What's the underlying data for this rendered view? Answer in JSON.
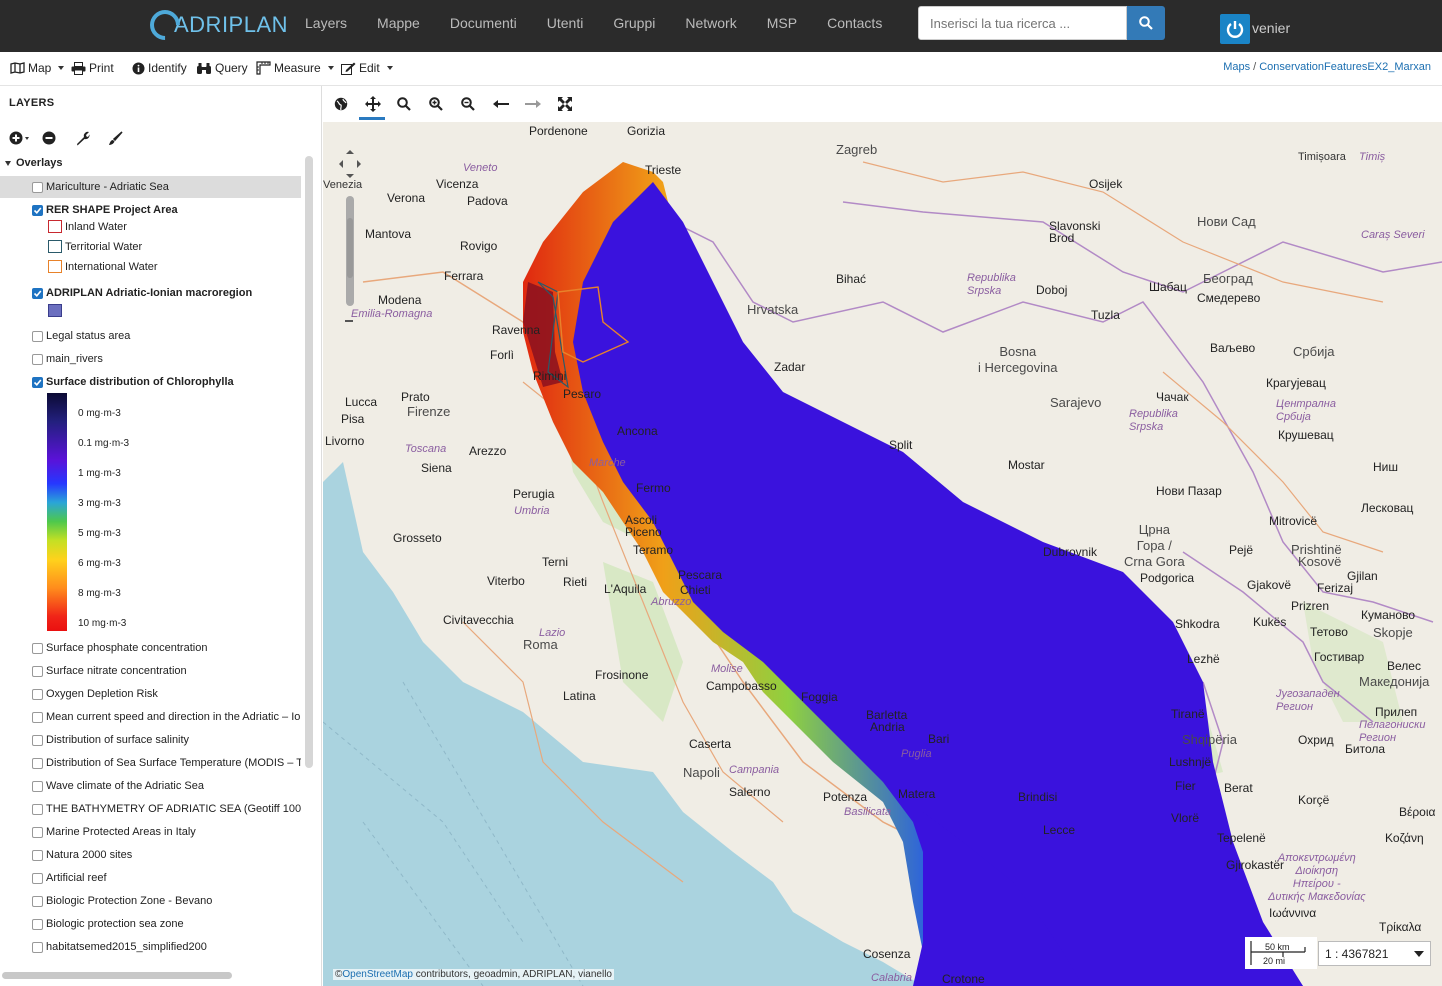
{
  "app": {
    "logo_text": "ADRIPLAN",
    "nav": [
      "Layers",
      "Mappe",
      "Documenti",
      "Utenti",
      "Gruppi",
      "Network",
      "MSP",
      "Contacts"
    ],
    "search_placeholder": "Inserisci la tua ricerca ...",
    "user": "venier"
  },
  "toolbar": {
    "map": "Map",
    "print": "Print",
    "identify": "Identify",
    "query": "Query",
    "measure": "Measure",
    "edit": "Edit",
    "breadcrumb_root": "Maps",
    "breadcrumb_sep": "/",
    "breadcrumb_current": "ConservationFeaturesEX2_Marxan"
  },
  "panel": {
    "title": "LAYERS",
    "group": "Overlays",
    "layers": [
      {
        "label": "Mariculture - Adriatic Sea",
        "checked": false
      },
      {
        "label": "RER SHAPE Project Area",
        "checked": true
      },
      {
        "label": "ADRIPLAN Adriatic-Ionian macroregion",
        "checked": true
      },
      {
        "label": "Legal status area",
        "checked": false
      },
      {
        "label": "main_rivers",
        "checked": false
      },
      {
        "label": "Surface distribution of Chlorophylla",
        "checked": true
      },
      {
        "label": "Surface phosphate concentration",
        "checked": false
      },
      {
        "label": "Surface nitrate concentration",
        "checked": false
      },
      {
        "label": "Oxygen Depletion Risk",
        "checked": false
      },
      {
        "label": "Mean current speed and direction in the Adriatic – Io",
        "checked": false
      },
      {
        "label": "Distribution of surface salinity",
        "checked": false
      },
      {
        "label": "Distribution of Sea Surface Temperature (MODIS – T",
        "checked": false
      },
      {
        "label": "Wave climate of the Adriatic Sea",
        "checked": false
      },
      {
        "label": "THE BATHYMETRY OF ADRIATIC SEA (Geotiff 100",
        "checked": false
      },
      {
        "label": "Marine Protected Areas in Italy",
        "checked": false
      },
      {
        "label": "Natura 2000 sites",
        "checked": false
      },
      {
        "label": "Artificial reef",
        "checked": false
      },
      {
        "label": "Biologic Protection Zone - Bevano",
        "checked": false
      },
      {
        "label": "Biologic protection sea zone",
        "checked": false
      },
      {
        "label": "habitatsemed2015_simplified200",
        "checked": false
      }
    ],
    "rer_legend": [
      {
        "label": "Inland Water",
        "color": "#c8292f"
      },
      {
        "label": "Territorial Water",
        "color": "#2a5a6a"
      },
      {
        "label": "International Water",
        "color": "#e8822a"
      }
    ],
    "macroregion_color": "#6b6fbf",
    "chl_legend": [
      "0 mg·m-3",
      "0.1 mg·m-3",
      "1 mg·m-3",
      "3 mg·m-3",
      "5 mg·m-3",
      "6 mg·m-3",
      "8 mg·m-3",
      "10 mg·m-3"
    ]
  },
  "map": {
    "labels": {
      "zagreb": "Zagreb",
      "trieste": "Trieste",
      "venezia": "Venezia",
      "padova": "Padova",
      "vicenza": "Vicenza",
      "verona": "Verona",
      "pordenone": "Pordenone",
      "gorizia": "Gorizia",
      "veneto": "Veneto",
      "mantova": "Mantova",
      "rovigo": "Rovigo",
      "ferrara": "Ferrara",
      "modena": "Modena",
      "emilia": "Emilia-Romagna",
      "ravenna": "Ravenna",
      "forli": "Forlì",
      "rimini": "Rimini",
      "pesaro": "Pesaro",
      "ancona": "Ancona",
      "prato": "Prato",
      "firenze": "Firenze",
      "lucca": "Lucca",
      "pisa": "Pisa",
      "livorno": "Livorno",
      "toscana": "Toscana",
      "arezzo": "Arezzo",
      "siena": "Siena",
      "grosseto": "Grosseto",
      "perugia": "Perugia",
      "umbria": "Umbria",
      "marche": "Marche",
      "fermo": "Fermo",
      "ascoli": "Ascoli Piceno",
      "teramo": "Teramo",
      "terni": "Terni",
      "viterbo": "Viterbo",
      "rieti": "Rieti",
      "laquila": "L'Aquila",
      "abruzzo": "Abruzzo",
      "pescara": "Pescara",
      "chieti": "Chieti",
      "civitavecchia": "Civitavecchia",
      "lazio": "Lazio",
      "roma": "Roma",
      "frosinone": "Frosinone",
      "latina": "Latina",
      "molise": "Molise",
      "campobasso": "Campobasso",
      "foggia": "Foggia",
      "barletta": "Barletta",
      "andria": "Andria",
      "bari": "Bari",
      "caserta": "Caserta",
      "napoli": "Napoli",
      "campania": "Campania",
      "salerno": "Salerno",
      "potenza": "Potenza",
      "puglia": "Puglia",
      "basilicata": "Basilicata",
      "matera": "Matera",
      "brindisi": "Brindisi",
      "lecce": "Lecce",
      "cosenza": "Cosenza",
      "calabria": "Calabria",
      "osijek": "Osijek",
      "timisoara": "Timișoara",
      "timis": "Timiș",
      "novisad": "Нови Сад",
      "slavonski": "Slavonski\nBrod",
      "caras": "Caraș Severi",
      "bihac": "Bihać",
      "hrvatska": "Hrvatska",
      "republika": "Republika\nSrpska",
      "doboj": "Doboj",
      "tuzla": "Tuzla",
      "beograd": "Београд",
      "sabac": "Шабац",
      "smederevo": "Смедерево",
      "valjevo": "Ваљево",
      "srbija": "Србија",
      "zadar": "Zadar",
      "bosna": "Bosna\ni Hercegovina",
      "sarajevo": "Sarajevo",
      "kragujevac": "Крагујевац",
      "cacak": "Чачак",
      "centralna": "Централна\nСрбија",
      "krusevac": "Крушевац",
      "split": "Split",
      "mostar": "Mostar",
      "republika2": "Republika\nSrpska",
      "nis": "Ниш",
      "novipazar": "Нови Пазар",
      "leskovac": "Лесковац",
      "dubrovnik": "Dubrovnik",
      "crnagora": "Црна\nГора /\nCrna Gora",
      "podgorica": "Podgorica",
      "peje": "Pejë",
      "mitrovice": "Mitrovicë",
      "prishtine": "Prishtinë",
      "kosove": "Kosovë",
      "gjakove": "Gjakovë",
      "ferizaj": "Ferizaj",
      "gjilan": "Gjilan",
      "prizren": "Prizren",
      "kumanovo": "Куманово",
      "kukes": "Kukës",
      "tetovo": "Тетово",
      "skopje": "Skopje",
      "shkodra": "Shkodra",
      "gostivar": "Гостивар",
      "veles": "Велес",
      "makedonija": "Македонија",
      "lezhe": "Lezhë",
      "jugozapaden": "Југозападен\nРегион",
      "prilep": "Прилеп",
      "pelagoniski": "Пелагониски\nРегион",
      "tirane": "Tiranë",
      "shqiperia": "Shqipëria",
      "ohrid": "Охрид",
      "bitola": "Битола",
      "lushnje": "Lushnjë",
      "fier": "Fier",
      "berat": "Berat",
      "korce": "Korçë",
      "veroia": "Βέροια",
      "vlore": "Vlorë",
      "tepelene": "Tepelenë",
      "kozani": "Κοζάνη",
      "apokentromeni": "Αποκεντρωμένη\nΔιοίκηση\nΗπείρου -\nΔυτικής Μακεδονίας",
      "gjirokaster": "Gjirokastër",
      "ioannina": "Ιωάννινα",
      "trikala": "Τρίκαλα",
      "crotone": "Crotone"
    },
    "attribution_link": "OpenStreetMap",
    "attribution_rest": "contributors, geoadmin, ADRIPLAN, vianello",
    "scale_km": "50 km",
    "scale_mi": "20 mi",
    "scale_ratio": "1 : 4367821"
  }
}
